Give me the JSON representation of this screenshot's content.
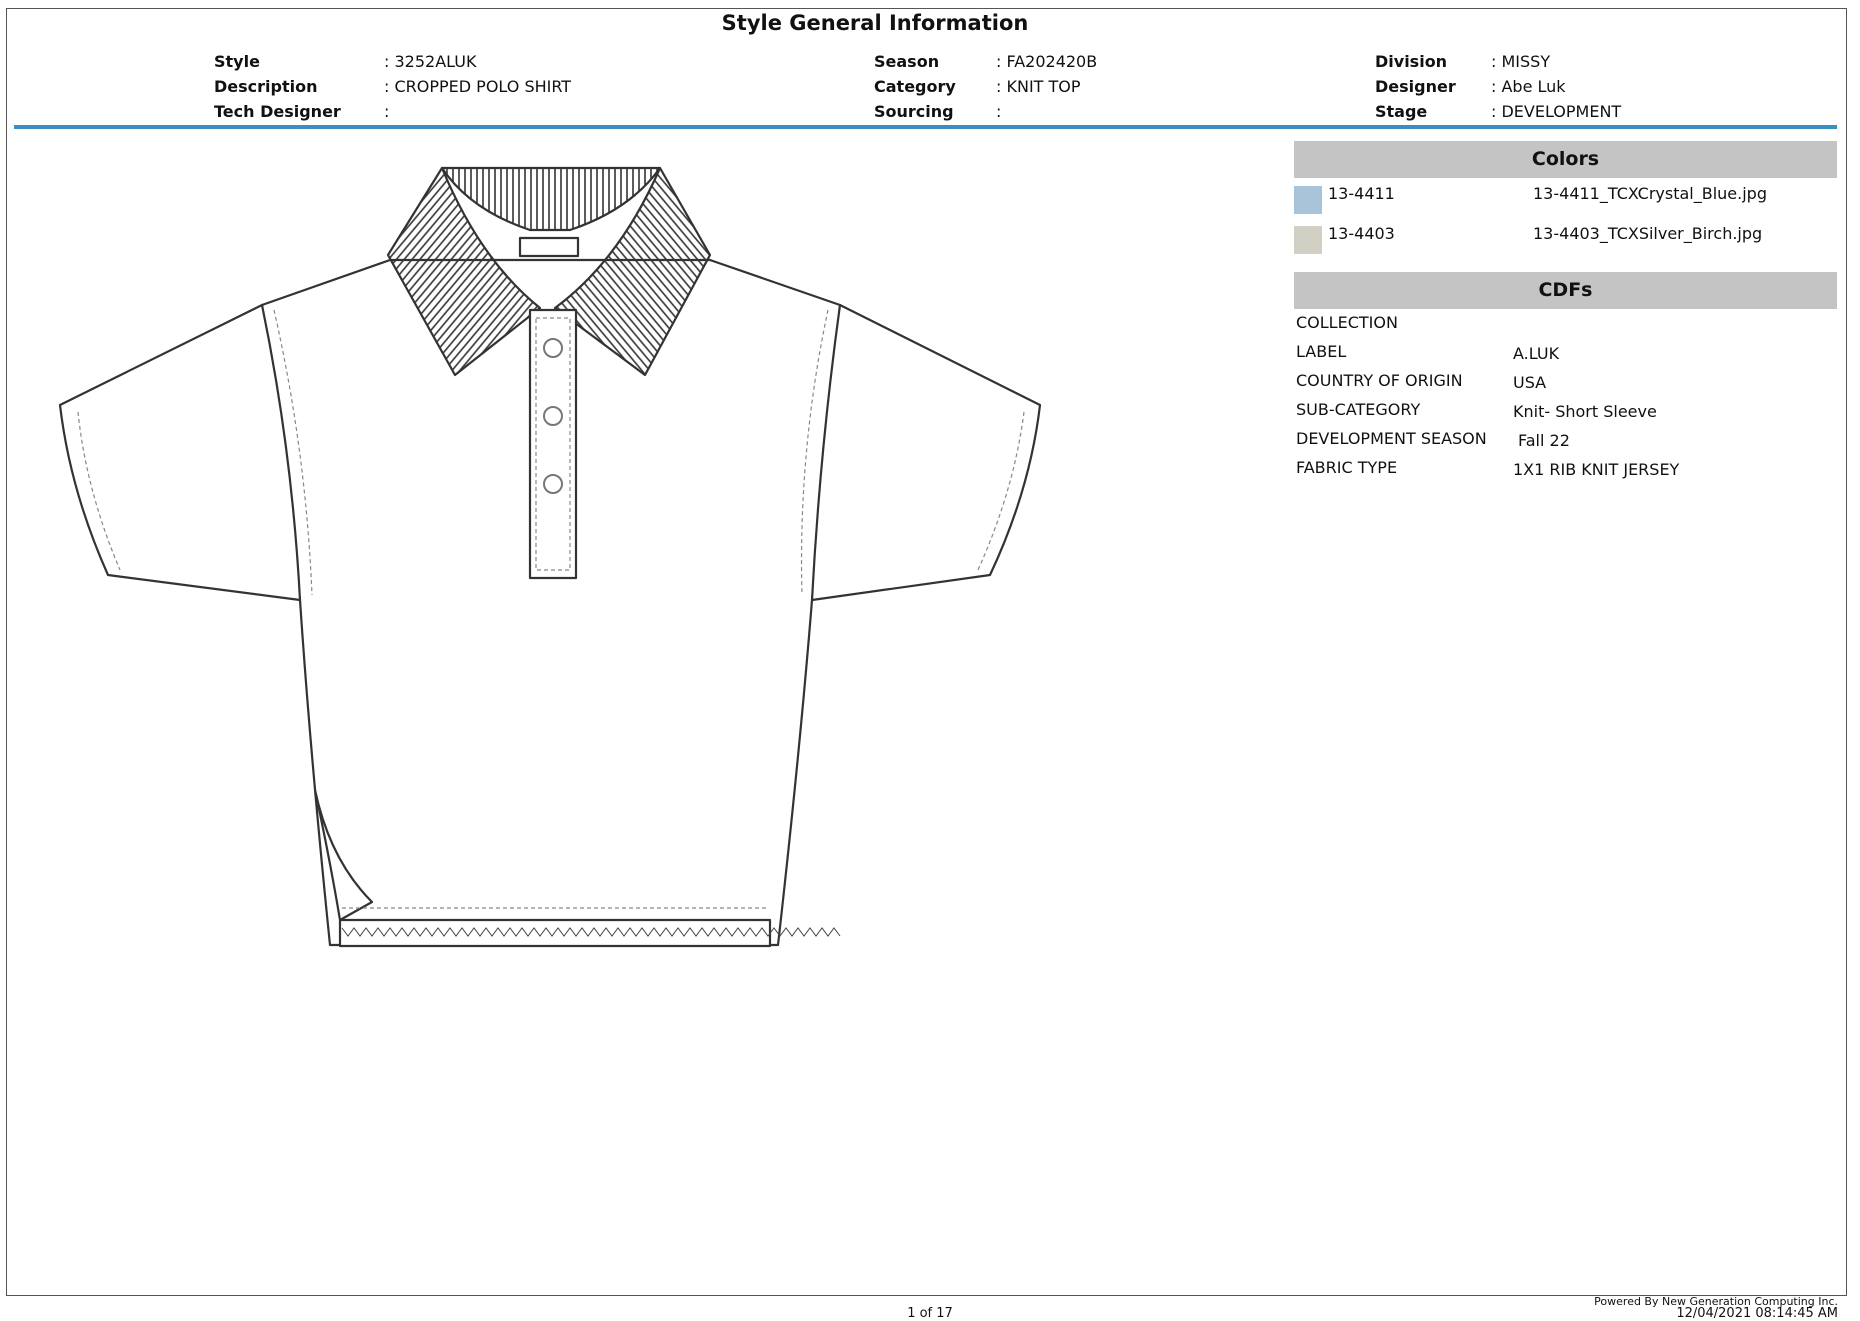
{
  "title": "Style General Information",
  "header": {
    "style_label": "Style",
    "style_value": ": 3252ALUK",
    "description_label": "Description",
    "description_value": ": CROPPED POLO SHIRT",
    "tech_designer_label": "Tech Designer",
    "tech_designer_value": ":",
    "season_label": "Season",
    "season_value": ": FA202420B",
    "category_label": "Category",
    "category_value": ": KNIT TOP",
    "sourcing_label": "Sourcing",
    "sourcing_value": ":",
    "division_label": "Division",
    "division_value": ": MISSY",
    "designer_label": "Designer",
    "designer_value": ": Abe Luk",
    "stage_label": "Stage",
    "stage_value": ": DEVELOPMENT"
  },
  "colors": {
    "heading": "Colors",
    "items": [
      {
        "code": "13-4411",
        "file": "13-4411_TCXCrystal_Blue.jpg",
        "swatch": "#a9c4d8"
      },
      {
        "code": "13-4403",
        "file": "13-4403_TCXSilver_Birch.jpg",
        "swatch": "#d2cfc4"
      }
    ]
  },
  "cdfs": {
    "heading": "CDFs",
    "rows": [
      {
        "label": "COLLECTION",
        "value": ""
      },
      {
        "label": "LABEL",
        "value": "A.LUK"
      },
      {
        "label": "COUNTRY OF ORIGIN",
        "value": "USA"
      },
      {
        "label": "SUB-CATEGORY",
        "value": "Knit- Short Sleeve"
      },
      {
        "label": "DEVELOPMENT SEASON",
        "value": "Fall 22"
      },
      {
        "label": "FABRIC TYPE",
        "value": "1X1 RIB KNIT JERSEY"
      }
    ]
  },
  "footer": {
    "page": "1 of 17",
    "powered_by": "Powered By New Generation Computing Inc.",
    "timestamp": "12/04/2021 08:14:45 AM"
  },
  "accent_color": "#3b8fc0"
}
